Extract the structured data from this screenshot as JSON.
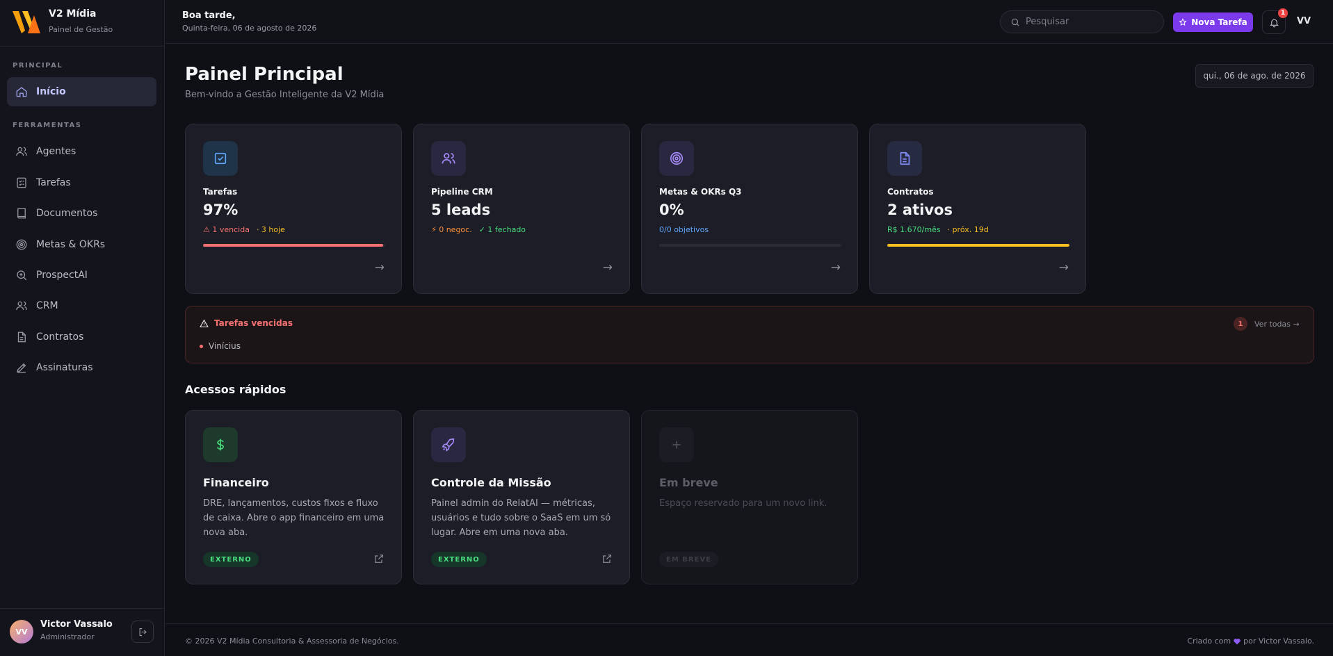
{
  "brand": {
    "name": "V2 Mídia",
    "subtitle": "Painel de Gestão"
  },
  "sidebar": {
    "sections": [
      {
        "label": "PRINCIPAL"
      },
      {
        "label": "FERRAMENTAS"
      }
    ],
    "items": [
      {
        "label": "Início",
        "icon": "home-icon",
        "active": true
      },
      {
        "label": "Agentes",
        "icon": "users-icon"
      },
      {
        "label": "Tarefas",
        "icon": "checklist-icon"
      },
      {
        "label": "Documentos",
        "icon": "book-icon"
      },
      {
        "label": "Metas & OKRs",
        "icon": "target-icon"
      },
      {
        "label": "ProspectAI",
        "icon": "search-plus-icon"
      },
      {
        "label": "CRM",
        "icon": "users-icon"
      },
      {
        "label": "Contratos",
        "icon": "document-icon"
      },
      {
        "label": "Assinaturas",
        "icon": "pen-icon"
      }
    ]
  },
  "user": {
    "initials": "VV",
    "name": "Victor Vassalo",
    "role": "Administrador"
  },
  "topbar": {
    "greeting": "Boa tarde,",
    "date": "Quinta-feira, 06 de agosto de 2026",
    "search_placeholder": "Pesquisar",
    "new_task_label": "Nova Tarefa",
    "notification_count": "1",
    "initials": "VV"
  },
  "header": {
    "title": "Painel Principal",
    "subtitle": "Bem-vindo a Gestão Inteligente da V2 Mídia",
    "date_pill": "qui., 06 de ago. de 2026"
  },
  "stats": [
    {
      "title": "Tarefas",
      "value": "97%",
      "meta1": "⚠ 1 vencida",
      "meta2": "· 3 hoje",
      "meta1_color": "#f87171",
      "meta2_color": "#fbbf24",
      "progress": 0.99,
      "bar_color": "#f87171",
      "icon": "checkbox-icon",
      "icon_bg": "#1f3448",
      "icon_color": "#60a5fa"
    },
    {
      "title": "Pipeline CRM",
      "value": "5 leads",
      "meta1": "⚡ 0 negoc.",
      "meta2": "✓ 1 fechado",
      "meta1_color": "#fb923c",
      "meta2_color": "#4ade80",
      "progress": null,
      "icon": "users-icon",
      "icon_bg": "#2a2840",
      "icon_color": "#a78bfa"
    },
    {
      "title": "Metas & OKRs Q3",
      "value": "0%",
      "meta1": "0/0 objetivos",
      "meta2": "",
      "meta1_color": "#60a5fa",
      "meta2_color": "#60a5fa",
      "progress": 0,
      "bar_color": "#60a5fa",
      "icon": "target-icon",
      "icon_bg": "#2a2840",
      "icon_color": "#a78bfa"
    },
    {
      "title": "Contratos",
      "value": "2 ativos",
      "meta1": "R$ 1.670/mês",
      "meta2": "· próx. 19d",
      "meta1_color": "#4ade80",
      "meta2_color": "#fbbf24",
      "progress": 1,
      "bar_color": "#fbbf24",
      "icon": "document-icon",
      "icon_bg": "#262b42",
      "icon_color": "#818cf8"
    }
  ],
  "overdue": {
    "title": "Tarefas vencidas",
    "count": "1",
    "link": "Ver todas →",
    "items": [
      "Vinícius"
    ]
  },
  "quick": {
    "title": "Acessos rápidos",
    "cards": [
      {
        "title": "Financeiro",
        "desc": "DRE, lançamentos, custos fixos e fluxo de caixa. Abre o app financeiro em uma nova aba.",
        "tag": "EXTERNO",
        "icon": "dollar-icon"
      },
      {
        "title": "Controle da Missão",
        "desc": "Painel admin do RelatAI — métricas, usuários e tudo sobre o SaaS em um só lugar. Abre em uma nova aba.",
        "tag": "EXTERNO",
        "icon": "rocket-icon"
      },
      {
        "title": "Em breve",
        "desc": "Espaço reservado para um novo link.",
        "tag": "EM BREVE",
        "icon": "plus-icon"
      }
    ]
  },
  "footer": {
    "left": "© 2026 V2 Mídia Consultoria & Assessoria de Negócios.",
    "right_prefix": "Criado com",
    "right_suffix": "por Victor Vassalo."
  },
  "colors": {
    "accent": "#7c3aed",
    "background": "#0f1016",
    "card": "#1c1d26",
    "danger": "#f87171"
  }
}
